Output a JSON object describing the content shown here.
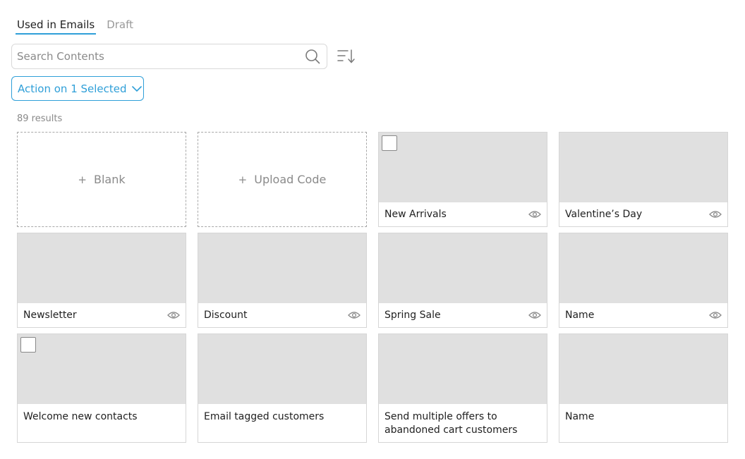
{
  "tabs": [
    {
      "label": "Used in Emails",
      "active": true
    },
    {
      "label": "Draft",
      "active": false
    }
  ],
  "search": {
    "placeholder": "Search Contents",
    "value": ""
  },
  "icons": {
    "search": "search-icon",
    "sort": "sort-descending-icon",
    "chevron": "chevron-down-icon",
    "preview": "eye-icon",
    "plus": "plus-icon"
  },
  "action_button": {
    "label": "Action on 1 Selected"
  },
  "results": {
    "label": "89 results"
  },
  "create_cards": [
    {
      "plus": "+",
      "label": "Blank"
    },
    {
      "plus": "+",
      "label": "Upload Code"
    }
  ],
  "cards": [
    {
      "name": "New Arrivals",
      "checkbox": true,
      "preview": true
    },
    {
      "name": "Valentine’s Day",
      "checkbox": false,
      "preview": true
    },
    {
      "name": "Newsletter",
      "checkbox": false,
      "preview": true
    },
    {
      "name": "Discount",
      "checkbox": false,
      "preview": true
    },
    {
      "name": "Spring Sale",
      "checkbox": false,
      "preview": true
    },
    {
      "name": "Name",
      "checkbox": false,
      "preview": true
    },
    {
      "name": "Welcome new contacts",
      "checkbox": true,
      "preview": false
    },
    {
      "name": "Email tagged customers",
      "checkbox": false,
      "preview": false
    },
    {
      "name": "Send multiple offers to abandoned cart customers",
      "checkbox": false,
      "preview": false
    },
    {
      "name": "Name",
      "checkbox": false,
      "preview": false
    }
  ],
  "colors": {
    "accent": "#2f9fd8",
    "thumb": "#e0e0e0",
    "border": "#d6d6d6",
    "muted": "#8a8a8a"
  }
}
